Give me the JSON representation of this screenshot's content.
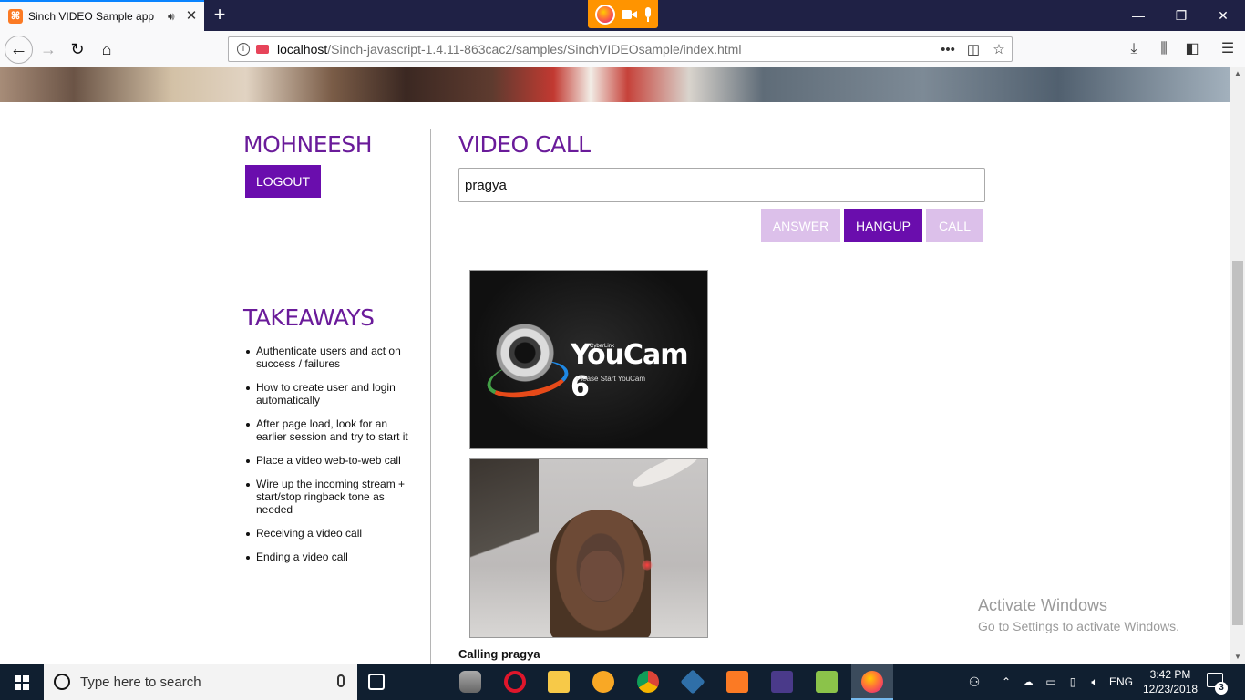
{
  "browser": {
    "tab_title": "Sinch VIDEO Sample app",
    "url_host": "localhost",
    "url_path": "/Sinch-javascript-1.4.11-863cac2/samples/SinchVIDEOsample/index.html"
  },
  "page": {
    "username": "MOHNEESH",
    "logout_label": "LOGOUT",
    "video_call_heading": "VIDEO CALL",
    "callee_value": "pragya",
    "answer_label": "ANSWER",
    "hangup_label": "HANGUP",
    "call_label": "CALL",
    "takeaways_heading": "TAKEAWAYS",
    "takeaways": [
      "Authenticate users and act on success / failures",
      "How to create user and login automatically",
      "After page load, look for an earlier session and try to start it",
      "Place a video web-to-web call",
      "Wire up the incoming stream + start/stop ringback tone as needed",
      "Receiving a video call",
      "Ending a video call"
    ],
    "remote_video": {
      "brand_small": "CyberLink",
      "title": "YouCam 6",
      "subtitle": "Please Start YouCam"
    },
    "call_status": "Calling pragya"
  },
  "watermark": {
    "line1": "Activate Windows",
    "line2": "Go to Settings to activate Windows."
  },
  "taskbar": {
    "search_placeholder": "Type here to search",
    "language": "ENG",
    "time": "3:42 PM",
    "date": "12/23/2018",
    "notification_count": "3"
  },
  "colors": {
    "accent_purple": "#6a0dad",
    "heading_purple": "#6a1b9a",
    "disabled_button": "#dcc0ea",
    "sharing_indicator": "#ff9400"
  }
}
